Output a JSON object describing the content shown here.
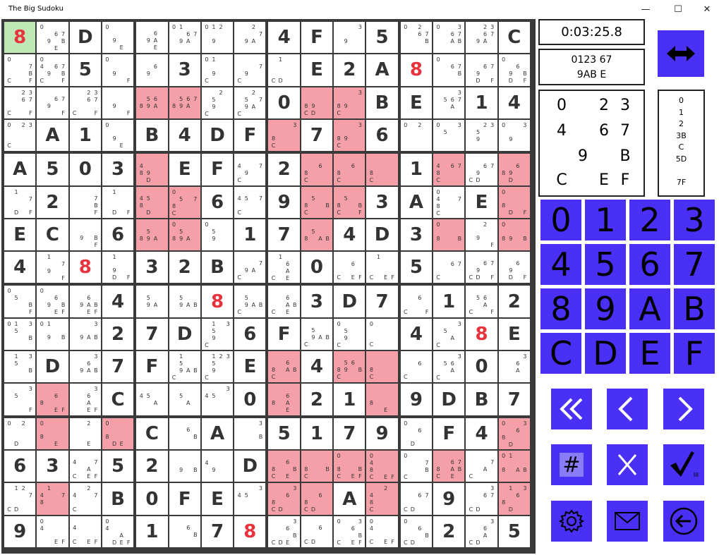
{
  "window": {
    "title": "The Big Sudoku",
    "minimize": "—",
    "maximize": "☐",
    "close": "✕"
  },
  "timer": "0:03:25.8",
  "candidate_summary": {
    "line1": "0123     67",
    "line2": "9AB     E"
  },
  "big_candidates": [
    "0",
    "",
    "2",
    "3",
    "4",
    "",
    "6",
    "7",
    "",
    "9",
    "",
    "B",
    "C",
    "",
    "E",
    "F"
  ],
  "column_list": [
    "0",
    "1",
    "2",
    "3B",
    "C",
    "5D",
    "",
    "7F"
  ],
  "keypad": [
    "0",
    "1",
    "2",
    "3",
    "4",
    "5",
    "6",
    "7",
    "8",
    "9",
    "A",
    "B",
    "C",
    "D",
    "E",
    "F"
  ],
  "controls": {
    "swap": "swap-arrows-icon",
    "first": "«",
    "prev": "‹",
    "next": "›",
    "hash": "#",
    "clear": "X",
    "check": "✓",
    "check_sub": "III"
  },
  "colors": {
    "accent": "#4a2ff5",
    "highlight": "#f5a0a8",
    "selected": "#bfe8b6",
    "given_red": "#e8323c"
  },
  "grid": [
    [
      "8",
      "0 67 9B E",
      "D",
      "0 9 E",
      "6 9A E",
      "01 67 9A",
      "012 9",
      "2 7 9A",
      "4",
      "F",
      "3 9",
      "5",
      "02 67 B",
      "0 3 67 AB",
      "23 67 9A",
      "C"
    ],
    [
      "0 7 B CF",
      "0 4 67 9B CF",
      "5",
      "0 9 F",
      "6 9",
      "3",
      "01 9 C",
      "7 9 C",
      "1 CD",
      "E",
      "2",
      "A",
      "8",
      "0 67 B",
      "67 9 DF",
      "0 6 9B DF"
    ],
    [
      "23 67 CF",
      "67 9 F",
      "23 67 CF",
      "9 F",
      "56 89A",
      "567 89A",
      "2 5 9 C",
      "2 57 9A C",
      "0",
      "89 CD",
      "3 89 C",
      "B",
      "E",
      "3 567 A",
      "1",
      "4"
    ],
    [
      "0 23 C",
      "A",
      "1",
      "0 9 E",
      "B",
      "4",
      "D",
      "F",
      "3 8 C",
      "7",
      "3 89 C",
      "6",
      "0 2",
      "0 5 3",
      "23 5 9",
      "0 3 9"
    ],
    [
      "A",
      "5",
      "0",
      "3",
      "4 89 D",
      "E",
      "F",
      "4 7 9 C",
      "2",
      "6 8 C",
      "6 8 C",
      "8 C",
      "1",
      "4 67 8 C",
      "67 9 CD",
      "6 89 D"
    ],
    [
      "1 7 DF",
      "2",
      "7 B F",
      "1 DF",
      "45 8 D",
      "0 57 8 C",
      "6",
      "45 7 C",
      "9",
      "5 8 B C",
      "5 8 B CF",
      "3",
      "A",
      "0 4 7 8 C",
      "E",
      "0 8 DF"
    ],
    [
      "E",
      "C",
      "9 B F",
      "6",
      "5 89A",
      "0 5 89A",
      "0 5 9",
      "1",
      "7",
      "5 8 AB",
      "4",
      "D",
      "3",
      "0 8 B",
      "2 9 F",
      "0 89 B"
    ],
    [
      "4",
      "1 7 9 F",
      "8",
      "1 9 DF",
      "3",
      "2",
      "B",
      "7 9A C",
      "1 6 A CE",
      "0",
      "6 CEF",
      "1 CEF",
      "5",
      "67 C",
      "67 9 CDF",
      "6 9 DF"
    ],
    [
      "0 5 B F",
      "0 6 9B EF",
      "6 9AB EF",
      "4",
      "5 9A",
      "5 9AB",
      "8",
      "5 9AB C",
      "6 AB CE",
      "3",
      "D",
      "7",
      "6 C F",
      "1",
      "56 A C F",
      "2"
    ],
    [
      "01 3 5 B",
      "01 9 B",
      "3 9AB",
      "2",
      "7",
      "D",
      "1 3 5 9 C",
      "6",
      "F",
      "5 9AB C",
      "0 5 9 C",
      "0 C",
      "4",
      "3 5 A C",
      "8",
      "E"
    ],
    [
      "1 3 5 B",
      "D",
      "3 6 9AB",
      "7",
      "F",
      "1 5 9AB C",
      "123 5 9 C",
      "E",
      "6 8 AB C",
      "4",
      "56 89 B C",
      "8 C",
      "6 C",
      "3 56 A C",
      "0",
      "3 6 A"
    ],
    [
      "5 3 F",
      "6 8 EF",
      "3 6 A EF",
      "C",
      "45 A",
      "5 A",
      "45 3",
      "0",
      "6 8 A E",
      "2",
      "1",
      "8 E",
      "9",
      "D",
      "B",
      "7"
    ],
    [
      "0 2 D",
      "0 8 E",
      "2 E",
      "0 8 DE",
      "C",
      "6 B",
      "A",
      "3 B",
      "5",
      "1",
      "7",
      "9",
      "0 6 D",
      "F",
      "4",
      "0 3 6 8 D"
    ],
    [
      "6",
      "3",
      "4 7 A CEF",
      "5",
      "2",
      "9 B",
      "4 9",
      "D",
      "6 8 B CE",
      "8 B C",
      "0 8 B CEF",
      "0 4 8 C EF",
      "0 7 B C",
      "6 7 8 AB CE",
      "7 A C",
      "01 8 AB"
    ],
    [
      "12 7 CD",
      "1 4 7 8",
      "4 2 7 C",
      "B",
      "0",
      "F",
      "E",
      "45 3",
      "3 6 8 CD",
      "6 8 CD",
      "A",
      "2 4 8 C",
      "67 CD",
      "9",
      "3 67 CD",
      "1 3 6 8 D"
    ],
    [
      "9",
      "0 4 EF",
      "4 CEF",
      "0 4 ADEF",
      "1",
      "6 B",
      "7",
      "8",
      "6 3 B CDE",
      "6 CD",
      "0 3 6 B CEF",
      "0 4 CEF",
      "0 6 B CD",
      "2",
      "6 3 CD A",
      "5"
    ]
  ],
  "pink_cells": [
    [
      2,
      4
    ],
    [
      2,
      5
    ],
    [
      2,
      9
    ],
    [
      2,
      10
    ],
    [
      3,
      8
    ],
    [
      3,
      10
    ],
    [
      4,
      4
    ],
    [
      4,
      9
    ],
    [
      4,
      10
    ],
    [
      4,
      11
    ],
    [
      4,
      13
    ],
    [
      4,
      15
    ],
    [
      5,
      4
    ],
    [
      5,
      5
    ],
    [
      5,
      9
    ],
    [
      5,
      10
    ],
    [
      5,
      15
    ],
    [
      6,
      4
    ],
    [
      6,
      5
    ],
    [
      6,
      9
    ],
    [
      6,
      13
    ],
    [
      6,
      15
    ],
    [
      10,
      8
    ],
    [
      10,
      10
    ],
    [
      10,
      11
    ],
    [
      11,
      1
    ],
    [
      11,
      8
    ],
    [
      11,
      11
    ],
    [
      12,
      1
    ],
    [
      12,
      3
    ],
    [
      12,
      15
    ],
    [
      13,
      8
    ],
    [
      13,
      9
    ],
    [
      13,
      10
    ],
    [
      13,
      11
    ],
    [
      13,
      13
    ],
    [
      13,
      15
    ],
    [
      14,
      1
    ],
    [
      14,
      8
    ],
    [
      14,
      9
    ],
    [
      14,
      11
    ],
    [
      14,
      15
    ]
  ],
  "red_cells": [
    [
      0,
      0
    ],
    [
      1,
      12
    ],
    [
      7,
      2
    ],
    [
      8,
      6
    ],
    [
      9,
      14
    ],
    [
      15,
      7
    ]
  ],
  "selected_cell": [
    0,
    0
  ],
  "given_cells": [
    [
      0,
      2
    ],
    [
      0,
      8
    ],
    [
      0,
      9
    ],
    [
      0,
      11
    ],
    [
      0,
      15
    ],
    [
      1,
      2
    ],
    [
      1,
      5
    ],
    [
      1,
      9
    ],
    [
      1,
      10
    ],
    [
      1,
      11
    ],
    [
      2,
      8
    ],
    [
      2,
      11
    ],
    [
      2,
      12
    ],
    [
      2,
      14
    ],
    [
      2,
      15
    ],
    [
      3,
      1
    ],
    [
      3,
      2
    ],
    [
      3,
      4
    ],
    [
      3,
      5
    ],
    [
      3,
      6
    ],
    [
      3,
      7
    ],
    [
      3,
      9
    ],
    [
      3,
      11
    ],
    [
      4,
      0
    ],
    [
      4,
      1
    ],
    [
      4,
      2
    ],
    [
      4,
      3
    ],
    [
      4,
      5
    ],
    [
      4,
      6
    ],
    [
      4,
      8
    ],
    [
      4,
      12
    ],
    [
      5,
      1
    ],
    [
      5,
      6
    ],
    [
      5,
      8
    ],
    [
      5,
      11
    ],
    [
      5,
      12
    ],
    [
      5,
      14
    ],
    [
      6,
      0
    ],
    [
      6,
      1
    ],
    [
      6,
      3
    ],
    [
      6,
      7
    ],
    [
      6,
      8
    ],
    [
      6,
      10
    ],
    [
      6,
      11
    ],
    [
      6,
      12
    ],
    [
      7,
      0
    ],
    [
      7,
      4
    ],
    [
      7,
      5
    ],
    [
      7,
      6
    ],
    [
      7,
      9
    ],
    [
      7,
      12
    ],
    [
      8,
      3
    ],
    [
      8,
      9
    ],
    [
      8,
      10
    ],
    [
      8,
      11
    ],
    [
      8,
      13
    ],
    [
      8,
      15
    ],
    [
      9,
      3
    ],
    [
      9,
      4
    ],
    [
      9,
      5
    ],
    [
      9,
      7
    ],
    [
      9,
      8
    ],
    [
      9,
      12
    ],
    [
      9,
      15
    ],
    [
      10,
      1
    ],
    [
      10,
      3
    ],
    [
      10,
      4
    ],
    [
      10,
      7
    ],
    [
      10,
      9
    ],
    [
      10,
      14
    ],
    [
      11,
      3
    ],
    [
      11,
      7
    ],
    [
      11,
      9
    ],
    [
      11,
      10
    ],
    [
      11,
      12
    ],
    [
      11,
      13
    ],
    [
      11,
      14
    ],
    [
      11,
      15
    ],
    [
      12,
      4
    ],
    [
      12,
      6
    ],
    [
      12,
      8
    ],
    [
      12,
      9
    ],
    [
      12,
      10
    ],
    [
      12,
      11
    ],
    [
      12,
      13
    ],
    [
      12,
      14
    ],
    [
      13,
      0
    ],
    [
      13,
      1
    ],
    [
      13,
      3
    ],
    [
      13,
      4
    ],
    [
      13,
      7
    ],
    [
      14,
      3
    ],
    [
      14,
      4
    ],
    [
      14,
      5
    ],
    [
      14,
      6
    ],
    [
      14,
      10
    ],
    [
      14,
      13
    ],
    [
      15,
      0
    ],
    [
      15,
      4
    ],
    [
      15,
      6
    ],
    [
      15,
      13
    ],
    [
      15,
      15
    ]
  ]
}
